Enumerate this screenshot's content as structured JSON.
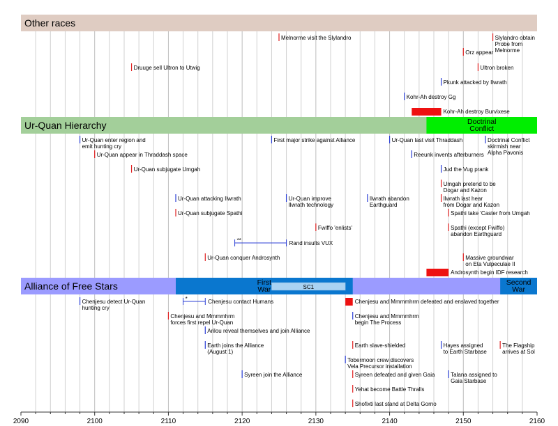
{
  "chart_data": {
    "type": "timeline",
    "xlim": [
      2090,
      2160
    ],
    "x_ticks": [
      2090,
      2100,
      2110,
      2120,
      2130,
      2140,
      2150,
      2160
    ],
    "colors": {
      "point_red": "#e02020",
      "point_blue": "#2b3fd6",
      "bar_red": "#ee1111",
      "grid": "#d0d0d0",
      "axis": "#333333"
    },
    "sections": [
      {
        "title": "Other races",
        "color": "#dfccc2",
        "eras": [],
        "events": [
          {
            "year": 2125,
            "color": "red",
            "row": 0,
            "label": [
              "Melnorme visit the Slylandro"
            ]
          },
          {
            "year": 2154,
            "color": "red",
            "row": 0,
            "label": [
              "Slylandro obtain",
              "Probe from",
              "Melnorme"
            ]
          },
          {
            "year": 2150,
            "color": "red",
            "row": 1,
            "label": [
              "Orz appear"
            ]
          },
          {
            "year": 2105,
            "color": "red",
            "row": 2,
            "label": [
              "Druuge sell Ultron to Utwig"
            ]
          },
          {
            "year": 2152,
            "color": "red",
            "row": 2,
            "label": [
              "Ultron broken"
            ]
          },
          {
            "year": 2147,
            "color": "blue",
            "row": 3,
            "label": [
              "Pkunk attacked by Ilwrath"
            ]
          },
          {
            "year": 2142,
            "color": "blue",
            "row": 4,
            "label": [
              "Kohr-Ah destroy Gg"
            ]
          },
          {
            "year": 2143,
            "end": 2147,
            "color": "bar",
            "row": 5,
            "label": [
              "Kohr-Ah destroy Burvixese"
            ]
          }
        ]
      },
      {
        "title": "Ur-Quan Hierarchy",
        "color": "#a3cf9a",
        "eras": [
          {
            "start": 2145,
            "end": 2160,
            "color": "#00ee00",
            "label": [
              "Doctrinal",
              "Conflict"
            ]
          }
        ],
        "events": [
          {
            "year": 2098,
            "color": "blue",
            "row": 0,
            "label": [
              "Ur-Quan enter region and",
              "emit hunting cry"
            ]
          },
          {
            "year": 2124,
            "color": "blue",
            "row": 0,
            "label": [
              "First major strike against Alliance"
            ]
          },
          {
            "year": 2140,
            "color": "blue",
            "row": 0,
            "label": [
              "Ur-Quan last visit Thraddash"
            ]
          },
          {
            "year": 2153,
            "color": "blue",
            "row": 0,
            "label": [
              "Doctrinal Conflict",
              "skirmish near",
              "Alpha Pavonis"
            ]
          },
          {
            "year": 2100,
            "color": "red",
            "row": 1,
            "label": [
              "Ur-Quan appear in Thraddash space"
            ]
          },
          {
            "year": 2143,
            "color": "blue",
            "row": 1,
            "label": [
              "Reeunk invents afterburners"
            ]
          },
          {
            "year": 2105,
            "color": "red",
            "row": 2,
            "label": [
              "Ur-Quan subjugate Umgah"
            ]
          },
          {
            "year": 2147,
            "color": "blue",
            "row": 2,
            "label": [
              "Jud the Vug prank"
            ]
          },
          {
            "year": 2147,
            "color": "red",
            "row": 3,
            "label": [
              "Umgah pretend to be",
              "Dogar and Kazon"
            ]
          },
          {
            "year": 2111,
            "color": "blue",
            "row": 4,
            "label": [
              "Ur-Quan attacking Ilwrath"
            ]
          },
          {
            "year": 2126,
            "color": "blue",
            "row": 4,
            "label": [
              "Ur-Quan improve",
              "Ilwrath technology"
            ]
          },
          {
            "year": 2137,
            "color": "blue",
            "row": 4,
            "label": [
              "Ilwrath abandon",
              "Earthguard"
            ]
          },
          {
            "year": 2147,
            "color": "red",
            "row": 4,
            "label": [
              "Ilwrath last hear",
              "from Dogar and Kazon"
            ]
          },
          {
            "year": 2111,
            "color": "red",
            "row": 5,
            "label": [
              "Ur-Quan subjugate Spathi"
            ]
          },
          {
            "year": 2148,
            "color": "red",
            "row": 5,
            "label": [
              "Spathi take 'Caster from Umgah"
            ]
          },
          {
            "year": 2130,
            "color": "red",
            "row": 6,
            "label": [
              "Fwiffo 'enlists'"
            ]
          },
          {
            "year": 2148,
            "color": "red",
            "row": 6,
            "label": [
              "Spathi (except Fwiffo)",
              "abandon Earthguard"
            ]
          },
          {
            "year": 2119,
            "end": 2126,
            "color": "range",
            "mark": "**",
            "row": 7,
            "label": [
              "Rand insults VUX"
            ]
          },
          {
            "year": 2115,
            "color": "red",
            "row": 8,
            "label": [
              "Ur-Quan conquer Androsynth"
            ]
          },
          {
            "year": 2150,
            "color": "red",
            "row": 8,
            "label": [
              "Massive groundwar",
              "on Eta Vulpeculae II"
            ]
          },
          {
            "year": 2145,
            "end": 2148,
            "color": "bar",
            "row": 9,
            "label": [
              "Androsynth begin IDF research"
            ]
          }
        ]
      },
      {
        "title": "Alliance of Free Stars",
        "color": "#9b9bff",
        "eras": [
          {
            "start": 2111,
            "end": 2135,
            "color": "#0a77cf",
            "label": [
              "First",
              "War"
            ]
          },
          {
            "start": 2155,
            "end": 2160,
            "color": "#0a77cf",
            "label": [
              "Second",
              "War"
            ]
          }
        ],
        "suberas": [
          {
            "start": 2124,
            "end": 2134,
            "color": "#a9d2f2",
            "label": "SC1"
          }
        ],
        "events": [
          {
            "year": 2098,
            "color": "blue",
            "row": 0,
            "label": [
              "Chenjesu detect Ur-Quan",
              "hunting cry"
            ]
          },
          {
            "year": 2112,
            "end": 2115,
            "color": "range",
            "mark": "*",
            "row": 0,
            "label": [
              "Chenjesu contact Humans"
            ]
          },
          {
            "year": 2134,
            "end": 2135,
            "color": "bar",
            "row": 0,
            "label": [
              "Chenjesu and Mmmmhrm defeated and enslaved together"
            ]
          },
          {
            "year": 2110,
            "color": "red",
            "row": 1,
            "label": [
              "Chenjesu and Mmmmhrm",
              "forces first repel Ur-Quan"
            ]
          },
          {
            "year": 2135,
            "color": "blue",
            "row": 1,
            "label": [
              "Chenjesu and Mmmmhrm",
              "begin The Process"
            ]
          },
          {
            "year": 2115,
            "color": "blue",
            "row": 2,
            "label": [
              "Arilou reveal themselves and join Alliance"
            ]
          },
          {
            "year": 2115,
            "color": "blue",
            "row": 3,
            "label": [
              "Earth joins the Alliance",
              "(August 1)"
            ]
          },
          {
            "year": 2135,
            "color": "red",
            "row": 3,
            "label": [
              "Earth slave-shielded"
            ]
          },
          {
            "year": 2147,
            "color": "blue",
            "row": 3,
            "label": [
              "Hayes assigned",
              "to Earth Starbase"
            ]
          },
          {
            "year": 2155,
            "color": "red",
            "row": 3,
            "label": [
              "The Flagship",
              "arrives at Sol"
            ]
          },
          {
            "year": 2134,
            "color": "blue",
            "row": 4,
            "label": [
              "Tobermoon crew discovers",
              "Vela Precursor installation"
            ]
          },
          {
            "year": 2120,
            "color": "blue",
            "row": 5,
            "label": [
              "Syreen join the Alliance"
            ]
          },
          {
            "year": 2135,
            "color": "red",
            "row": 5,
            "label": [
              "Syreen defeated and given Gaia"
            ]
          },
          {
            "year": 2148,
            "color": "blue",
            "row": 5,
            "label": [
              "Talana assigned to",
              "Gaia Starbase"
            ]
          },
          {
            "year": 2135,
            "color": "red",
            "row": 6,
            "label": [
              "Yehat become Battle Thralls"
            ]
          },
          {
            "year": 2135,
            "color": "red",
            "row": 7,
            "label": [
              "Shofixti last stand at Delta Gorno"
            ]
          }
        ]
      }
    ]
  }
}
